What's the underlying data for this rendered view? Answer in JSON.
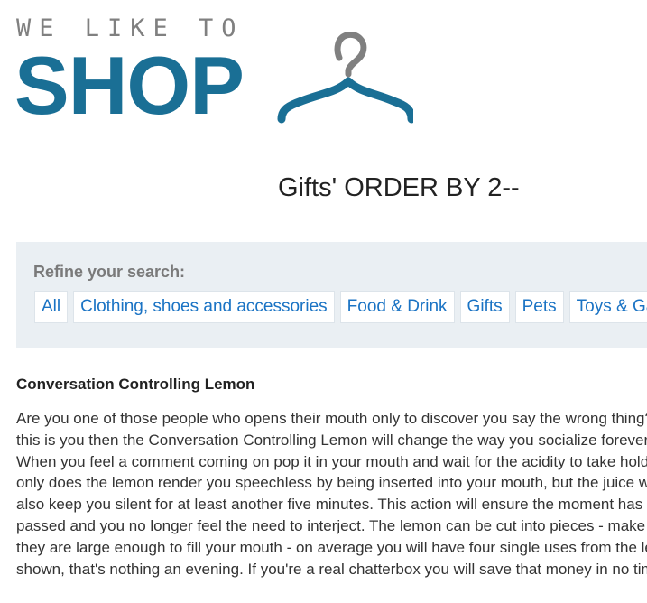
{
  "logo": {
    "tagline": "WE LIKE TO",
    "word": "SHOP",
    "icon": "coat-hanger-icon",
    "color": "#1a6f95"
  },
  "page": {
    "title": "Gifts' ORDER BY 2--"
  },
  "refine": {
    "label": "Refine your search:",
    "items": [
      {
        "label": "All"
      },
      {
        "label": "Clothing, shoes and accessories"
      },
      {
        "label": "Food & Drink"
      },
      {
        "label": "Gifts"
      },
      {
        "label": "Pets"
      },
      {
        "label": "Toys & Games"
      }
    ]
  },
  "product": {
    "title": "Conversation Controlling Lemon",
    "lines": [
      "Are you one of those people who opens their mouth only to discover you say the wrong thing? If",
      "this is you then the Conversation Controlling Lemon will change the way you socialize forever!",
      "When you feel a comment coming on pop it in your mouth and wait for the acidity to take hold. Not",
      "only does the lemon render you speechless by being inserted into your mouth, but the juice will",
      "also keep you silent for at least another five minutes. This action will ensure the moment has",
      "passed and you no longer feel the need to interject. The lemon can be cut into pieces - make sure",
      "they are large enough to fill your mouth - on average you will have four single uses from the lemon",
      "shown, that's nothing an evening. If you're a real chatterbox you will save that money in no time."
    ]
  }
}
